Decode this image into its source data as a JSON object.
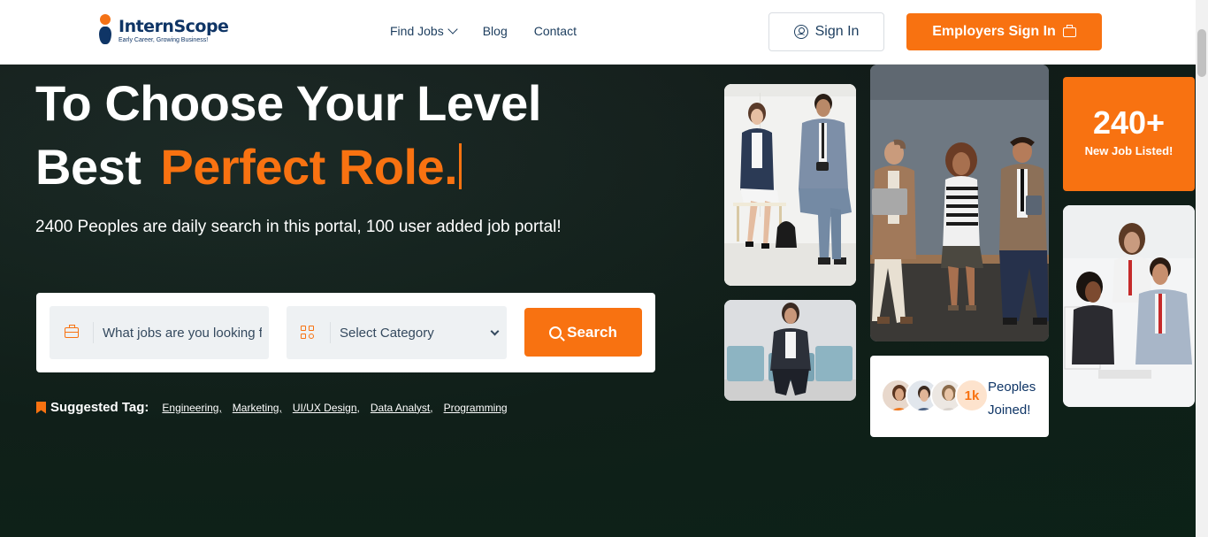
{
  "header": {
    "logo_name": "InternScope",
    "logo_tagline": "Early Career, Growing Business!",
    "nav": [
      {
        "label": "Find Jobs",
        "dropdown": true
      },
      {
        "label": "Blog"
      },
      {
        "label": "Contact"
      }
    ],
    "signin_label": "Sign In",
    "employers_label": "Employers Sign In"
  },
  "hero": {
    "title_line1": "To Choose Your Level",
    "title_line2_prefix": "Best",
    "title_line2_accent": "Perfect Role.",
    "subtitle": "2400 Peoples are daily search in this portal, 100 user added job portal!",
    "search": {
      "keyword_placeholder": "What jobs are you looking for?",
      "category_selected": "Select Category",
      "button_label": "Search"
    },
    "suggested": {
      "label": "Suggested Tag:",
      "tags": [
        "Engineering,",
        "Marketing,",
        "UI/UX Design,",
        "Data Analyst,",
        "Programming"
      ]
    },
    "stat": {
      "number": "240+",
      "label": "New Job Listed!"
    },
    "joined": {
      "count_badge": "1k",
      "text": "Peoples Joined!"
    }
  },
  "colors": {
    "accent": "#f87211",
    "brand_navy": "#0f3566",
    "hero_bg": "#121c19"
  },
  "icons": [
    "user-icon",
    "briefcase-icon",
    "category-grid-icon",
    "search-icon",
    "bookmark-icon",
    "chevron-down-icon"
  ]
}
